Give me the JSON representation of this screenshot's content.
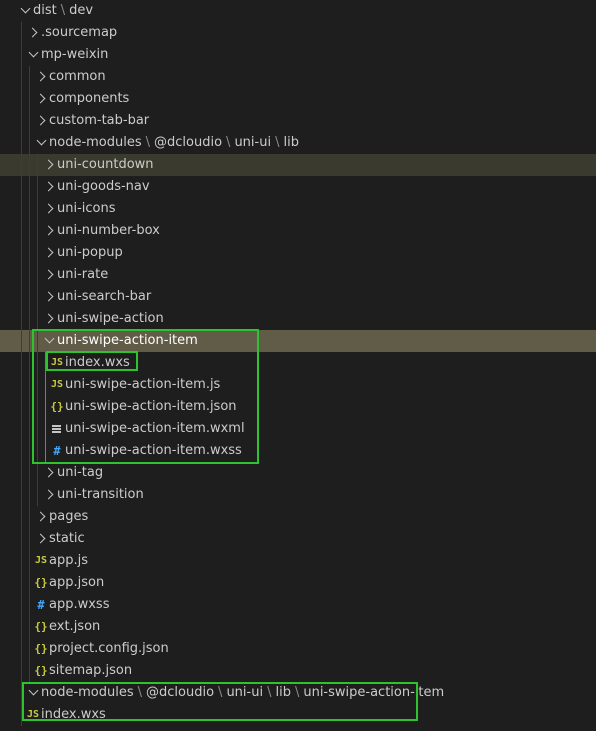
{
  "rows": [
    {
      "name": "folder-row-dist",
      "indent": 0,
      "kind": "folder",
      "open": true,
      "label": "",
      "path": [
        "dist",
        "dev"
      ]
    },
    {
      "name": "folder-row-sourcemap",
      "indent": 1,
      "kind": "folder",
      "open": false,
      "label": ".sourcemap"
    },
    {
      "name": "folder-row-mp-weixin",
      "indent": 1,
      "kind": "folder",
      "open": true,
      "label": "mp-weixin"
    },
    {
      "name": "folder-row-common",
      "indent": 2,
      "kind": "folder",
      "open": false,
      "label": "common"
    },
    {
      "name": "folder-row-components",
      "indent": 2,
      "kind": "folder",
      "open": false,
      "label": "components"
    },
    {
      "name": "folder-row-custom-tab-bar",
      "indent": 2,
      "kind": "folder",
      "open": false,
      "label": "custom-tab-bar"
    },
    {
      "name": "folder-row-node-modules",
      "indent": 2,
      "kind": "folder",
      "open": true,
      "label": "",
      "path": [
        "node-modules",
        "@dcloudio",
        "uni-ui",
        "lib"
      ]
    },
    {
      "name": "folder-row-uni-countdown",
      "indent": 3,
      "kind": "folder",
      "open": false,
      "label": "uni-countdown",
      "state": "hover"
    },
    {
      "name": "folder-row-uni-goods-nav",
      "indent": 3,
      "kind": "folder",
      "open": false,
      "label": "uni-goods-nav"
    },
    {
      "name": "folder-row-uni-icons",
      "indent": 3,
      "kind": "folder",
      "open": false,
      "label": "uni-icons"
    },
    {
      "name": "folder-row-uni-number-box",
      "indent": 3,
      "kind": "folder",
      "open": false,
      "label": "uni-number-box"
    },
    {
      "name": "folder-row-uni-popup",
      "indent": 3,
      "kind": "folder",
      "open": false,
      "label": "uni-popup"
    },
    {
      "name": "folder-row-uni-rate",
      "indent": 3,
      "kind": "folder",
      "open": false,
      "label": "uni-rate"
    },
    {
      "name": "folder-row-uni-search-bar",
      "indent": 3,
      "kind": "folder",
      "open": false,
      "label": "uni-search-bar"
    },
    {
      "name": "folder-row-uni-swipe-action",
      "indent": 3,
      "kind": "folder",
      "open": false,
      "label": "uni-swipe-action"
    },
    {
      "name": "folder-row-uni-swipe-action-item",
      "indent": 3,
      "kind": "folder",
      "open": true,
      "label": "uni-swipe-action-item",
      "state": "selected"
    },
    {
      "name": "file-row-index-wxs",
      "indent": 4,
      "kind": "js",
      "label": "index.wxs"
    },
    {
      "name": "file-row-uni-swipe-action-item-js",
      "indent": 4,
      "kind": "js",
      "label": "uni-swipe-action-item.js"
    },
    {
      "name": "file-row-uni-swipe-action-item-json",
      "indent": 4,
      "kind": "json",
      "label": "uni-swipe-action-item.json"
    },
    {
      "name": "file-row-uni-swipe-action-item-wxml",
      "indent": 4,
      "kind": "xml",
      "label": "uni-swipe-action-item.wxml"
    },
    {
      "name": "file-row-uni-swipe-action-item-wxss",
      "indent": 4,
      "kind": "css",
      "label": "uni-swipe-action-item.wxss"
    },
    {
      "name": "folder-row-uni-tag",
      "indent": 3,
      "kind": "folder",
      "open": false,
      "label": "uni-tag"
    },
    {
      "name": "folder-row-uni-transition",
      "indent": 3,
      "kind": "folder",
      "open": false,
      "label": "uni-transition"
    },
    {
      "name": "folder-row-pages",
      "indent": 2,
      "kind": "folder",
      "open": false,
      "label": "pages"
    },
    {
      "name": "folder-row-static",
      "indent": 2,
      "kind": "folder",
      "open": false,
      "label": "static"
    },
    {
      "name": "file-row-app-js",
      "indent": 2,
      "kind": "js",
      "label": "app.js"
    },
    {
      "name": "file-row-app-json",
      "indent": 2,
      "kind": "json",
      "label": "app.json"
    },
    {
      "name": "file-row-app-wxss",
      "indent": 2,
      "kind": "css",
      "label": "app.wxss"
    },
    {
      "name": "file-row-ext-json",
      "indent": 2,
      "kind": "json",
      "label": "ext.json"
    },
    {
      "name": "file-row-project-config-json",
      "indent": 2,
      "kind": "json",
      "label": "project.config.json"
    },
    {
      "name": "file-row-sitemap-json",
      "indent": 2,
      "kind": "json",
      "label": "sitemap.json"
    },
    {
      "name": "folder-row-node-modules-compact",
      "indent": 1,
      "kind": "folder",
      "open": true,
      "label": "",
      "path": [
        "node-modules",
        "@dcloudio",
        "uni-ui",
        "lib",
        "uni-swipe-action-item"
      ]
    },
    {
      "name": "file-row-index-wxs-compact",
      "indent": 1,
      "kind": "js",
      "label": "index.wxs"
    }
  ],
  "icons": {
    "js": "JS",
    "json": "{}",
    "css": "#"
  },
  "colors": {
    "background": "#1e1e1e",
    "selected_row": "#615c48",
    "hover_row": "#3a3a2e",
    "highlight_box": "#2fc22f",
    "js_icon": "#cbcb41",
    "json_icon": "#cbcb41",
    "css_icon": "#42a5f5"
  }
}
